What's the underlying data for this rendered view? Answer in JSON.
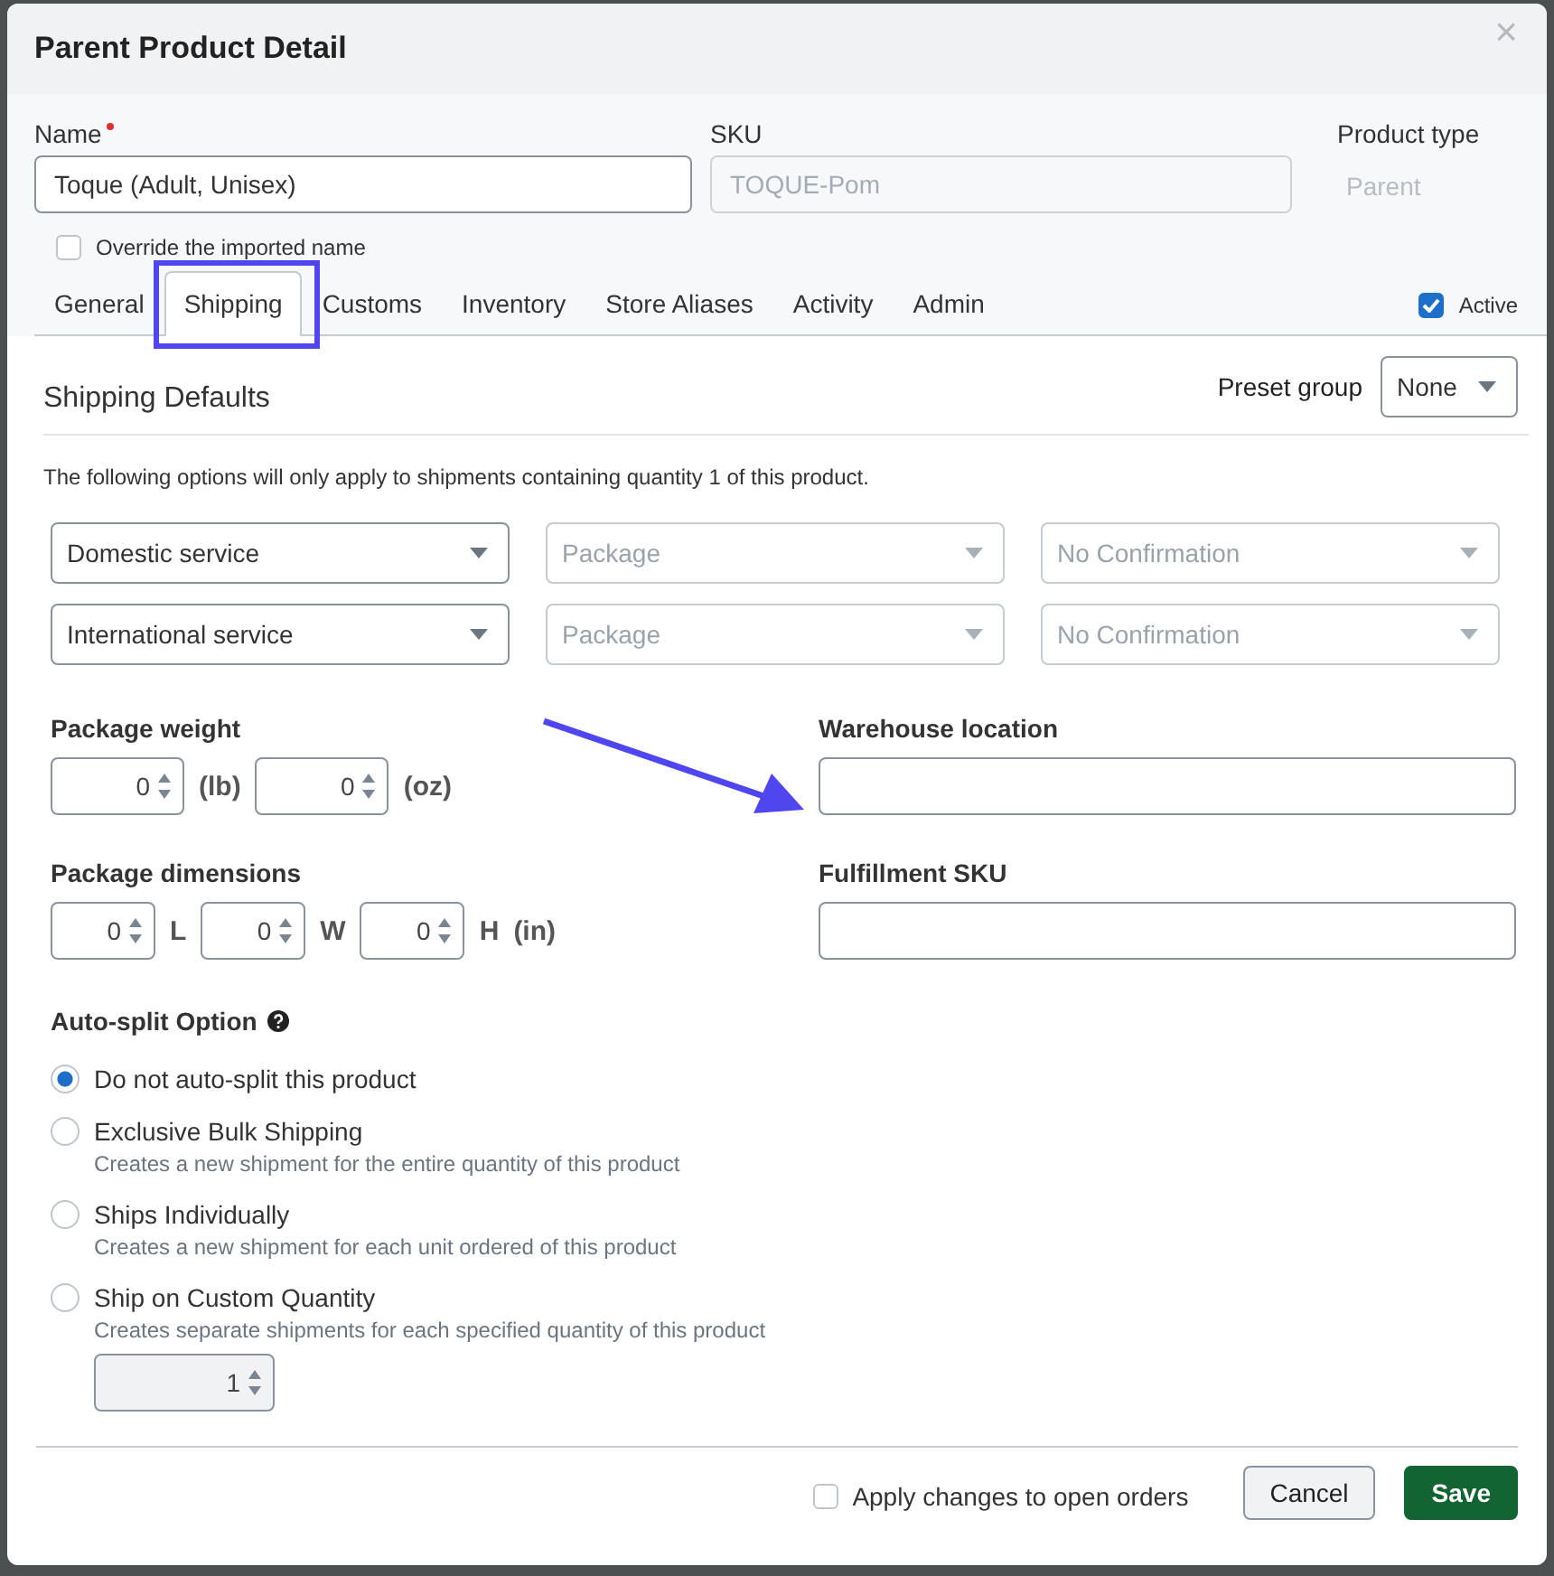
{
  "dialog": {
    "title": "Parent Product Detail",
    "close": "×"
  },
  "name_field": {
    "label": "Name",
    "required": true,
    "value": "Toque (Adult, Unisex)"
  },
  "sku_field": {
    "label": "SKU",
    "placeholder": "TOQUE-Pom"
  },
  "product_type": {
    "label": "Product type",
    "value": "Parent"
  },
  "override_name": {
    "label": "Override the imported name",
    "checked": false
  },
  "tabs": [
    {
      "label": "General",
      "selected": false,
      "highlighted": false
    },
    {
      "label": "Shipping",
      "selected": true,
      "highlighted": true
    },
    {
      "label": "Customs",
      "selected": false,
      "highlighted": false
    },
    {
      "label": "Inventory",
      "selected": false,
      "highlighted": false
    },
    {
      "label": "Store Aliases",
      "selected": false,
      "highlighted": false
    },
    {
      "label": "Activity",
      "selected": false,
      "highlighted": false
    },
    {
      "label": "Admin",
      "selected": false,
      "highlighted": false
    }
  ],
  "active": {
    "label": "Active",
    "checked": true
  },
  "section": {
    "title": "Shipping Defaults",
    "preset_label": "Preset group",
    "preset_value": "None"
  },
  "note": "The following options will only apply to shipments containing quantity 1 of this product.",
  "service_rows": [
    {
      "service": "Domestic service",
      "package": "Package",
      "confirmation": "No Confirmation"
    },
    {
      "service": "International service",
      "package": "Package",
      "confirmation": "No Confirmation"
    }
  ],
  "package_weight": {
    "label": "Package weight",
    "fields": [
      {
        "value": "0",
        "unit": "(lb)"
      },
      {
        "value": "0",
        "unit": "(oz)"
      }
    ]
  },
  "warehouse_location": {
    "label": "Warehouse location",
    "pointed_at": true
  },
  "package_dimensions": {
    "label": "Package dimensions",
    "fields": [
      {
        "value": "0",
        "unit": "L"
      },
      {
        "value": "0",
        "unit": "W"
      },
      {
        "value": "0",
        "unit": "H"
      }
    ],
    "unit": "(in)"
  },
  "fulfillment_sku": {
    "label": "Fulfillment SKU"
  },
  "auto_split": {
    "label": "Auto-split Option",
    "options": [
      {
        "label": "Do not auto-split this product",
        "selected": true
      },
      {
        "label": "Exclusive Bulk Shipping",
        "description": "Creates a new shipment for the entire quantity of this product",
        "selected": false
      },
      {
        "label": "Ships Individually",
        "description": "Creates a new shipment for each unit ordered of this product",
        "selected": false
      },
      {
        "label": "Ship on Custom Quantity",
        "description": "Creates separate shipments for each specified quantity of this product",
        "selected": false
      }
    ],
    "quantity": "1"
  },
  "footer": {
    "apply_label": "Apply changes to open orders",
    "apply_checked": false,
    "buttons": [
      "Cancel",
      "Save"
    ]
  }
}
